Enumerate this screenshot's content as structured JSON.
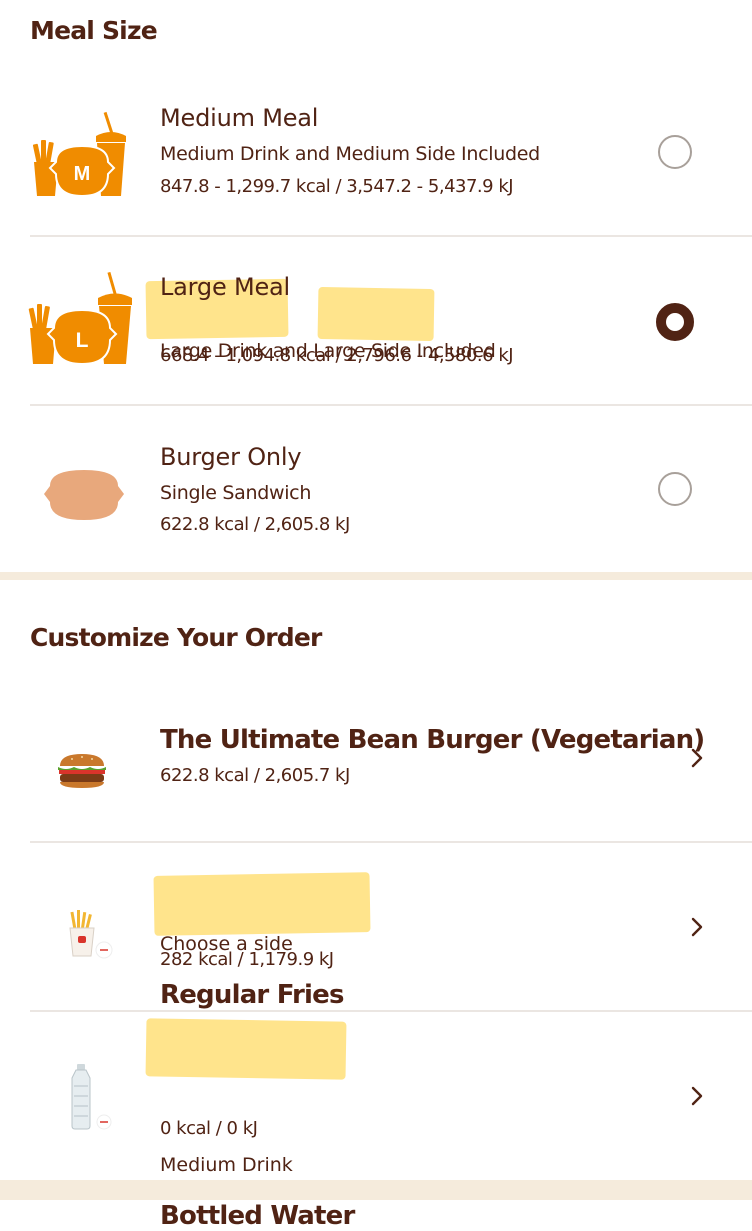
{
  "meal_size": {
    "title": "Meal Size",
    "options": [
      {
        "title": "Medium Meal",
        "subtitle": "Medium Drink and Medium Side Included",
        "kcal": "847.8 - 1,299.7 kcal / 3,547.2 - 5,437.9 kJ",
        "icon_letter": "M",
        "selected": false
      },
      {
        "title": "Large Meal",
        "subtitle_a": "Large Drink",
        "subtitle_b": " and ",
        "subtitle_c": "Large Side",
        "subtitle_d": " Included",
        "kcal": "668.4 - 1,094.8 kcal / 2,796.6 - 4,580.6 kJ",
        "icon_letter": "L",
        "selected": true
      },
      {
        "title": "Burger Only",
        "subtitle": "Single Sandwich",
        "kcal": "622.8 kcal / 2,605.8 kJ",
        "selected": false
      }
    ]
  },
  "customize": {
    "title": "Customize Your Order",
    "items": [
      {
        "title": "The Ultimate Bean Burger (Vegetarian)",
        "kcal": "622.8 kcal / 2,605.7 kJ",
        "icon": "burger-icon"
      },
      {
        "label": "Choose a side",
        "title": "Regular Fries",
        "kcal": "282 kcal / 1,179.9 kJ",
        "icon": "fries-icon"
      },
      {
        "label": "Medium Drink",
        "title": "Bottled Water",
        "kcal": "0 kcal / 0 kJ",
        "icon": "water-bottle-icon"
      }
    ]
  },
  "colors": {
    "brand_brown": "#502314",
    "brand_orange": "#f08c00",
    "tan": "#e8a87c",
    "highlight": "#ffe180",
    "band": "#f5ebdc"
  }
}
